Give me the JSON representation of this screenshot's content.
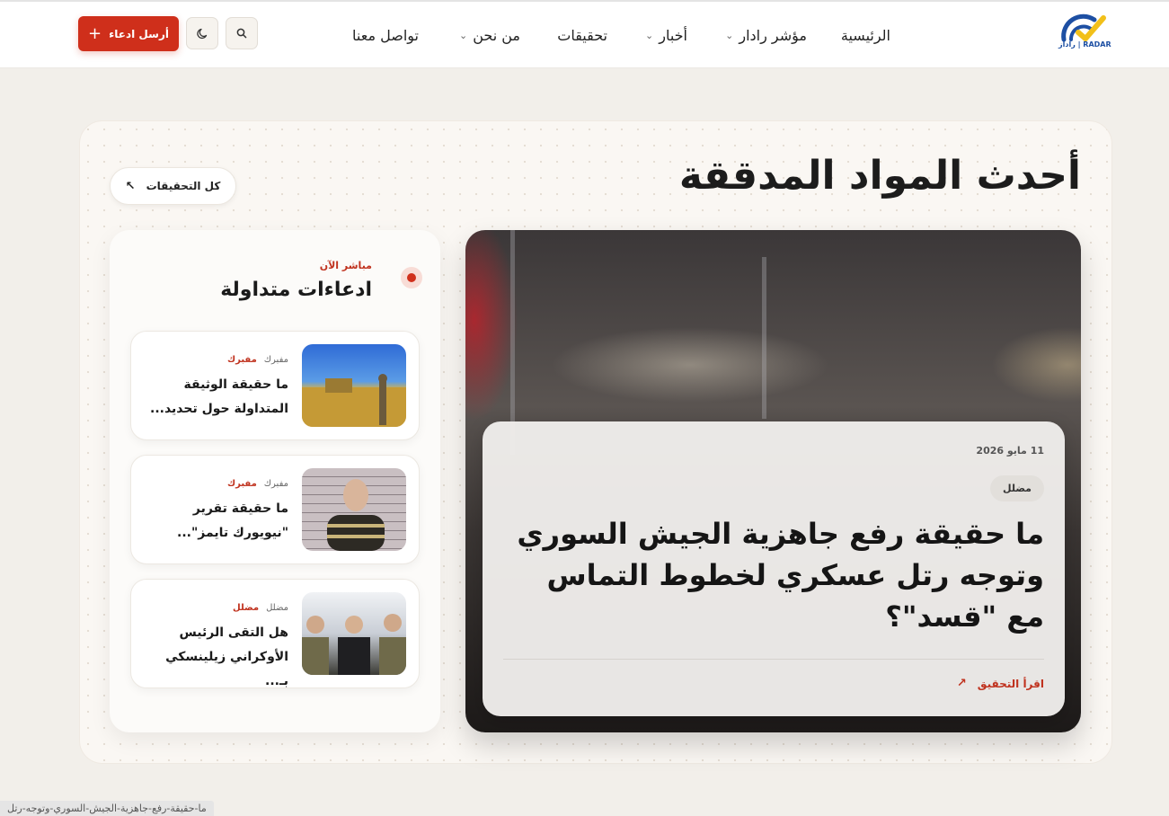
{
  "header": {
    "logo_text": "راداز | RADAR",
    "nav": [
      {
        "label": "الرئيسية",
        "dropdown": false
      },
      {
        "label": "مؤشر رادار",
        "dropdown": true
      },
      {
        "label": "أخبار",
        "dropdown": true
      },
      {
        "label": "تحقيقات",
        "dropdown": false
      },
      {
        "label": "من نحن",
        "dropdown": true
      },
      {
        "label": "تواصل معنا",
        "dropdown": false
      }
    ],
    "search_icon": "search-icon",
    "theme_icon": "moon-icon",
    "cta_label": "أرسل ادعاء"
  },
  "section": {
    "title": "أحدث المواد المدققة",
    "all_label": "كل التحقيقات"
  },
  "featured": {
    "date": "11 مايو 2026",
    "tag": "مضلل",
    "title": "ما حقيقة رفع جاهزية الجيش السوري وتوجه رتل عسكري لخطوط التماس مع \"قسد\"؟",
    "read_more": "اقرأ التحقيق"
  },
  "sidebar": {
    "live_label": "مباشر الآن",
    "title": "ادعاءات متداولة",
    "claims": [
      {
        "tag_gray": "مفبرك",
        "tag_red": "مفبرك",
        "title": "ما حقيقة الوثيقة المتداولة حول تحديد..."
      },
      {
        "tag_gray": "مفبرك",
        "tag_red": "مفبرك",
        "title": "ما حقيقة تقرير \"نيويورك تايمز\"..."
      },
      {
        "tag_gray": "مضلل",
        "tag_red": "مضلل",
        "title": "هل التقى الرئيس الأوكراني زيلينسكي بـ..."
      }
    ]
  },
  "status_bar": "ما-حقيقة-رفع-جاهزية-الجيش-السوري-وتوجه-رتل",
  "colors": {
    "accent": "#cf2f1b",
    "logo_blue": "#1d4fa3",
    "logo_yellow": "#f2c01a"
  }
}
